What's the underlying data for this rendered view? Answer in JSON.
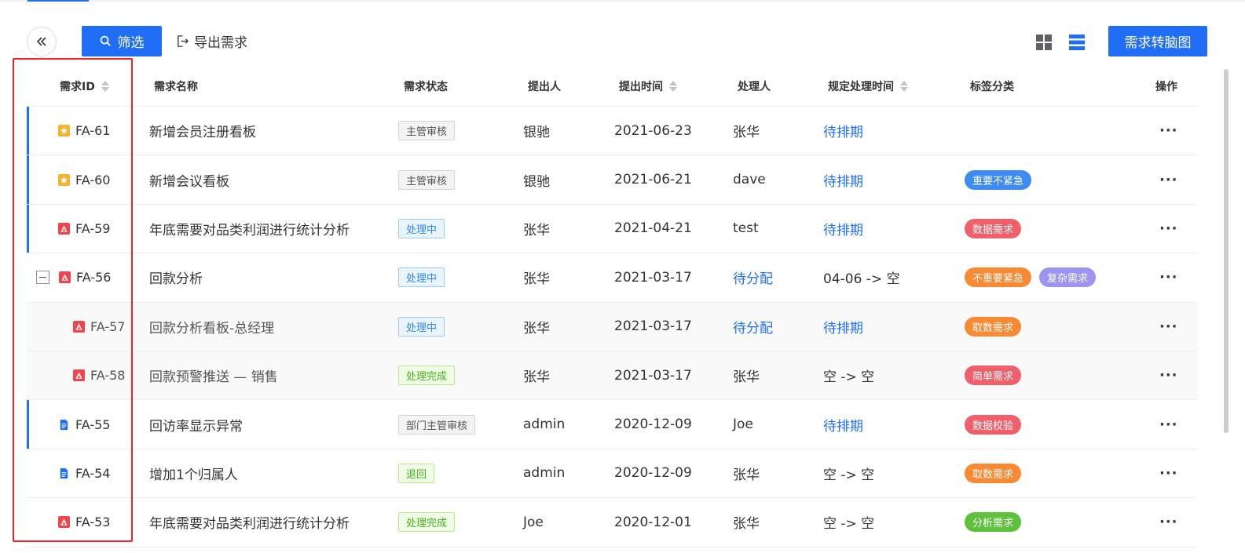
{
  "toolbar": {
    "filter_label": "筛选",
    "export_label": "导出需求",
    "mindmap_label": "需求转脑图"
  },
  "columns": {
    "id": "需求ID",
    "name": "需求名称",
    "status": "需求状态",
    "submitter": "提出人",
    "submit_time": "提出时间",
    "handler": "处理人",
    "deadline": "规定处理时间",
    "tags": "标签分类",
    "ops": "操作"
  },
  "colors": {
    "accent": "#1f6ef5",
    "tag_blue": "#3d8bf3",
    "tag_red": "#f0606a",
    "tag_orange": "#f98a34",
    "tag_purple": "#9b94f0",
    "tag_green": "#5ec13c"
  },
  "rows": [
    {
      "id": "FA-61",
      "icon": "star-icon",
      "name": "新增会员注册看板",
      "status": "主管审核",
      "status_style": "gray",
      "submitter": "银驰",
      "time": "2021-06-23",
      "handler": "张华",
      "handler_link": false,
      "deadline": "待排期",
      "deadline_link": true,
      "tags": [],
      "accent": true,
      "expand": false,
      "child": false,
      "ops": "···"
    },
    {
      "id": "FA-60",
      "icon": "star-icon",
      "name": "新增会议看板",
      "status": "主管审核",
      "status_style": "gray",
      "submitter": "银驰",
      "time": "2021-06-21",
      "handler": "dave",
      "handler_link": false,
      "deadline": "待排期",
      "deadline_link": true,
      "tags": [
        {
          "label": "重要不紧急",
          "color": "#3d8bf3"
        }
      ],
      "accent": true,
      "expand": false,
      "child": false,
      "ops": "···"
    },
    {
      "id": "FA-59",
      "icon": "bug-icon",
      "name": "年底需要对品类利润进行统计分析",
      "status": "处理中",
      "status_style": "blue",
      "submitter": "张华",
      "time": "2021-04-21",
      "handler": "test",
      "handler_link": false,
      "deadline": "待排期",
      "deadline_link": true,
      "tags": [
        {
          "label": "数据需求",
          "color": "#f0606a"
        }
      ],
      "accent": true,
      "expand": false,
      "child": false,
      "ops": "···"
    },
    {
      "id": "FA-56",
      "icon": "bug-icon",
      "name": "回款分析",
      "status": "处理中",
      "status_style": "blue",
      "submitter": "张华",
      "time": "2021-03-17",
      "handler": "待分配",
      "handler_link": true,
      "deadline": "04-06 -> 空",
      "deadline_link": false,
      "tags": [
        {
          "label": "不重要紧急",
          "color": "#f98a34"
        },
        {
          "label": "复杂需求",
          "color": "#9b94f0"
        }
      ],
      "accent": false,
      "expand": true,
      "child": false,
      "ops": "···"
    },
    {
      "id": "FA-57",
      "icon": "bug-icon",
      "name": "回款分析看板-总经理",
      "status": "处理中",
      "status_style": "blue",
      "submitter": "张华",
      "time": "2021-03-17",
      "handler": "待分配",
      "handler_link": true,
      "deadline": "待排期",
      "deadline_link": true,
      "tags": [
        {
          "label": "取数需求",
          "color": "#f98a34"
        }
      ],
      "accent": false,
      "expand": false,
      "child": true,
      "ops": "···"
    },
    {
      "id": "FA-58",
      "icon": "bug-icon",
      "name": "回款预警推送 — 销售",
      "status": "处理完成",
      "status_style": "green",
      "submitter": "张华",
      "time": "2021-03-17",
      "handler": "张华",
      "handler_link": false,
      "deadline": "空 -> 空",
      "deadline_link": false,
      "tags": [
        {
          "label": "简单需求",
          "color": "#f0606a"
        }
      ],
      "accent": false,
      "expand": false,
      "child": true,
      "ops": "···"
    },
    {
      "id": "FA-55",
      "icon": "doc-icon",
      "name": "回访率显示异常",
      "status": "部门主管审核",
      "status_style": "gray",
      "submitter": "admin",
      "time": "2020-12-09",
      "handler": "Joe",
      "handler_link": false,
      "deadline": "待排期",
      "deadline_link": true,
      "tags": [
        {
          "label": "数据校验",
          "color": "#f0606a"
        }
      ],
      "accent": true,
      "expand": false,
      "child": false,
      "ops": "···"
    },
    {
      "id": "FA-54",
      "icon": "doc-icon",
      "name": "增加1个归属人",
      "status": "退回",
      "status_style": "green",
      "submitter": "admin",
      "time": "2020-12-09",
      "handler": "张华",
      "handler_link": false,
      "deadline": "空 -> 空",
      "deadline_link": false,
      "tags": [
        {
          "label": "取数需求",
          "color": "#f98a34"
        }
      ],
      "accent": false,
      "expand": false,
      "child": false,
      "ops": "···"
    },
    {
      "id": "FA-53",
      "icon": "bug-icon",
      "name": "年底需要对品类利润进行统计分析",
      "status": "处理完成",
      "status_style": "green",
      "submitter": "Joe",
      "time": "2020-12-01",
      "handler": "张华",
      "handler_link": false,
      "deadline": "空 -> 空",
      "deadline_link": false,
      "tags": [
        {
          "label": "分析需求",
          "color": "#5ec13c"
        }
      ],
      "accent": false,
      "expand": false,
      "child": false,
      "ops": "···"
    }
  ]
}
